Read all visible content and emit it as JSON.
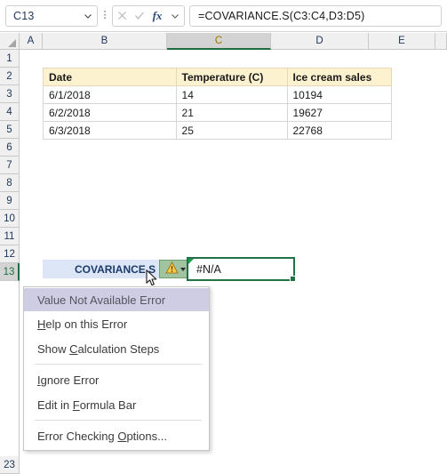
{
  "app": "Microsoft Excel",
  "formula_bar": {
    "name_box_value": "C13",
    "name_box_placeholder": "Name Box",
    "cancel_icon": "cancel-x-icon",
    "enter_icon": "enter-check-icon",
    "fx_label": "fx",
    "formula_value": "=COVARIANCE.S(C3:C4,D3:D5)",
    "formula_placeholder": "Formula Bar"
  },
  "grid": {
    "columns": [
      "A",
      "B",
      "C",
      "D",
      "E"
    ],
    "selected_column": "C",
    "rows": [
      "1",
      "2",
      "3",
      "4",
      "5",
      "6",
      "7",
      "8",
      "9",
      "10",
      "11",
      "12",
      "13"
    ],
    "bottom_row": "23",
    "selected_row": "13",
    "selected_cell": "C13"
  },
  "table": {
    "headers": [
      "Date",
      "Temperature (C)",
      "Ice cream sales"
    ],
    "rows": [
      [
        "6/1/2018",
        "14",
        "10194"
      ],
      [
        "6/2/2018",
        "21",
        "19627"
      ],
      [
        "6/3/2018",
        "25",
        "22768"
      ]
    ]
  },
  "result_row": {
    "label": "COVARIANCE.S",
    "value": "#N/A",
    "smarttag_icon": "warning-triangle-icon",
    "smarttag_caret_icon": "chevron-down-icon"
  },
  "context_menu": {
    "title": "Value Not Available Error",
    "items": [
      {
        "label": "Help on this Error",
        "accel_index": 0,
        "accel_len": 1
      },
      {
        "label": "Show Calculation Steps",
        "accel_index": 5,
        "accel_len": 1
      },
      {
        "label": "Ignore Error",
        "accel_index": 0,
        "accel_len": 1
      },
      {
        "label": "Edit in Formula Bar",
        "accel_index": 8,
        "accel_len": 1
      },
      {
        "label": "Error Checking Options...",
        "accel_index": 15,
        "accel_len": 1
      }
    ]
  },
  "colors": {
    "excel_green": "#217346",
    "header_fill": "#fdf2cf",
    "label_fill": "#dce6f6",
    "menu_title_fill": "#cfcde4",
    "warning_yellow": "#f2b721"
  }
}
